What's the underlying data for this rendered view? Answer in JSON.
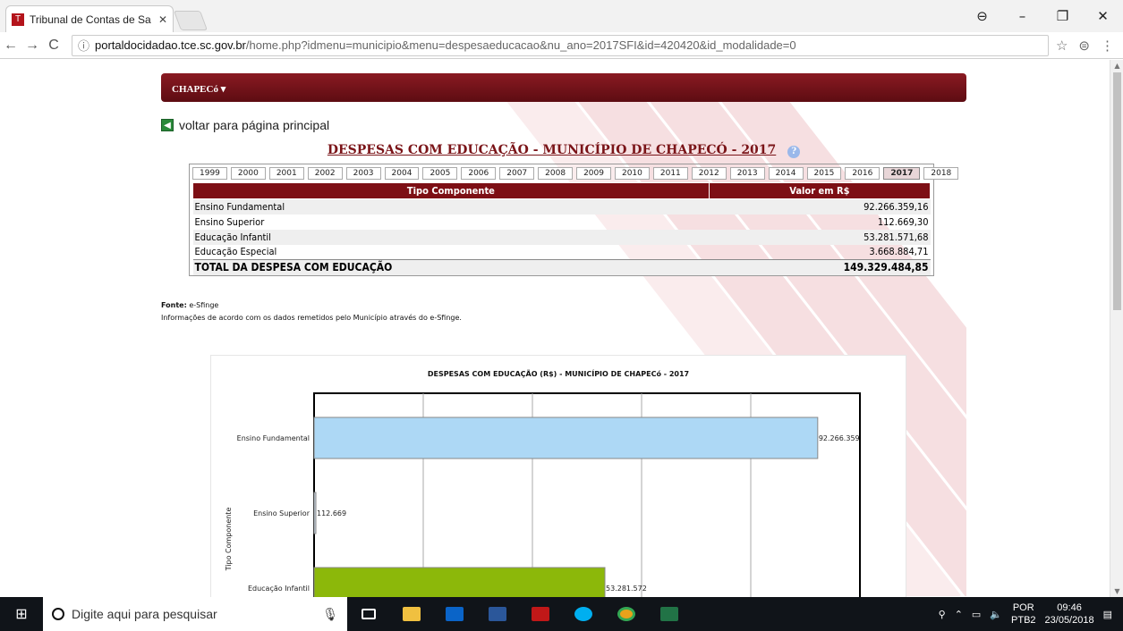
{
  "browser": {
    "tab_title": "Tribunal de Contas de Sa",
    "url_host": "portaldocidadao.tce.sc.gov.br",
    "url_path": "/home.php?idmenu=municipio&menu=despesaeducacao&nu_ano=2017SFI&id=420420&id_modalidade=0"
  },
  "page": {
    "menu_label": "CHAPECó ▾",
    "back_label": "voltar para página principal",
    "title": "DESPESAS COM EDUCAÇÃO - MUNICÍPIO DE CHAPECÓ - 2017",
    "years": [
      "1999",
      "2000",
      "2001",
      "2002",
      "2003",
      "2004",
      "2005",
      "2006",
      "2007",
      "2008",
      "2009",
      "2010",
      "2011",
      "2012",
      "2013",
      "2014",
      "2015",
      "2016",
      "2017",
      "2018"
    ],
    "selected_year": "2017",
    "table": {
      "headers": [
        "Tipo Componente",
        "Valor em R$"
      ],
      "rows": [
        [
          "Ensino Fundamental",
          "92.266.359,16"
        ],
        [
          "Ensino Superior",
          "112.669,30"
        ],
        [
          "Educação Infantil",
          "53.281.571,68"
        ],
        [
          "Educação Especial",
          "3.668.884,71"
        ]
      ],
      "total": [
        "TOTAL DA DESPESA COM EDUCAÇÃO",
        "149.329.484,85"
      ]
    },
    "source_label": "Fonte:",
    "source_value": "e-Sfinge",
    "source_note": "Informações de acordo com os dados remetidos pelo Município através do e-Sfinge."
  },
  "chart_data": {
    "type": "bar",
    "orientation": "horizontal",
    "title": "DESPESAS COM EDUCAÇÃO (R$) - MUNICÍPIO DE CHAPECó - 2017",
    "ylabel": "Tipo Componente",
    "categories": [
      "Ensino Fundamental",
      "Ensino Superior",
      "Educação Infantil"
    ],
    "values": [
      92266359,
      112669,
      53281572
    ],
    "value_labels": [
      "92.266.359",
      "112.669",
      "53.281.572"
    ],
    "colors": [
      "#add8f5",
      "#c9d6e4",
      "#8cb80a"
    ],
    "xlim": [
      0,
      100000000
    ],
    "grid": true
  },
  "taskbar": {
    "search_placeholder": "Digite aqui para pesquisar",
    "lang": "POR",
    "lang2": "PTB2",
    "time": "09:46",
    "date": "23/05/2018"
  }
}
